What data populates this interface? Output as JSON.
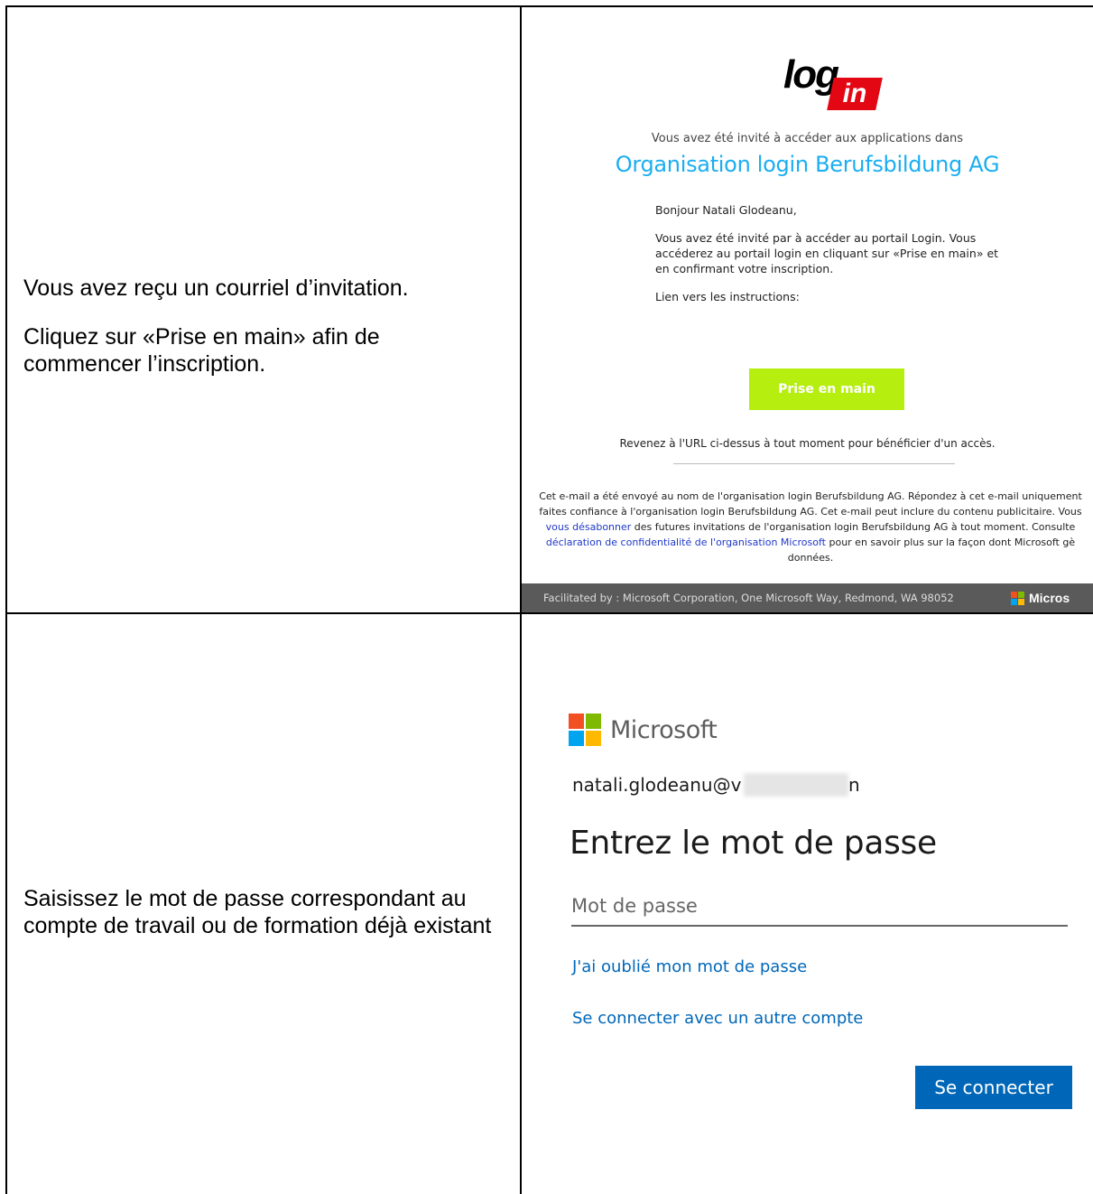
{
  "rows": [
    {
      "instructions": [
        "Vous avez reçu un courriel d’invitation.",
        "Cliquez sur «Prise en main» afin de commencer l’inscription."
      ]
    },
    {
      "instructions": [
        "Saisissez le mot de passe correspondant au compte de travail ou de formation déjà existant"
      ]
    }
  ],
  "email": {
    "logo_text_log": "log",
    "logo_text_in": "in",
    "invite_line": "Vous avez été invité à accéder aux applications dans",
    "org_name": "Organisation login Berufsbildung AG",
    "greeting": "Bonjour Natali Glodeanu,",
    "body": "Vous avez été invité par à accéder au portail Login. Vous accéderez au portail login en cliquant sur «Prise en main» et en confirmant votre inscription.",
    "instructions_link": "Lien vers les instructions:",
    "cta": "Prise en main",
    "revenez": "Revenez à l'URL ci-dessus à tout moment pour bénéficier d'un accès.",
    "fine_line1": "Cet e-mail a été envoyé au nom de l'organisation login Berufsbildung AG. Répondez à cet e-mail uniquement",
    "fine_line2": "faites confiance à l'organisation login Berufsbildung AG. Cet e-mail peut inclure du contenu publicitaire. Vous",
    "fine_unsubscribe": "vous désabonner",
    "fine_line3_rest": " des futures invitations de l'organisation login Berufsbildung AG à tout moment. Consulte",
    "fine_privacy": "déclaration de confidentialité de l'organisation Microsoft",
    "fine_line4_rest": " pour en savoir plus sur la façon dont Microsoft gè",
    "fine_line5": "données.",
    "footer_text": "Facilitated by : Microsoft Corporation, One Microsoft Way, Redmond, WA 98052",
    "footer_brand": "Micros"
  },
  "signin": {
    "brand": "Microsoft",
    "email_start": "natali.glodeanu@v",
    "email_end": "n",
    "heading": "Entrez le mot de passe",
    "password_placeholder": "Mot de passe",
    "forgot_link": "J'ai oublié mon mot de passe",
    "other_account_link": "Se connecter avec un autre compte",
    "signin_button": "Se connecter"
  },
  "colors": {
    "org_blue": "#1aaef0",
    "cta_green": "#b5ee0f",
    "ms_blue": "#0067b8",
    "footer_gray": "#5a5a5a",
    "login_red": "#e30613",
    "ms_red": "#f25022",
    "ms_green": "#7fba00",
    "ms_blue_sq": "#00a4ef",
    "ms_yellow": "#ffb900"
  }
}
